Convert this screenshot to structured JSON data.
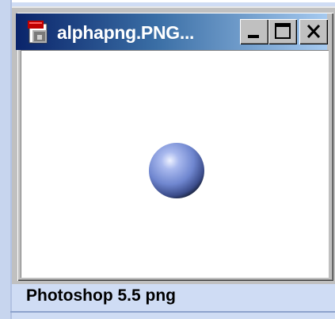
{
  "window": {
    "title": "alphapng.PNG...",
    "controls": {
      "minimize_icon": "minimize-icon",
      "maximize_icon": "maximize-icon",
      "close_icon": "close-icon"
    },
    "icon": "image-document-icon"
  },
  "content": {
    "image": "blue-sphere"
  },
  "caption": {
    "text": "Photoshop 5.5 png"
  },
  "colors": {
    "titlebar_start": "#0a246a",
    "titlebar_end": "#a6caf0",
    "page_background": "#cfdcf4",
    "window_chrome": "#c0c0c0",
    "sphere": "#7f95d6"
  }
}
